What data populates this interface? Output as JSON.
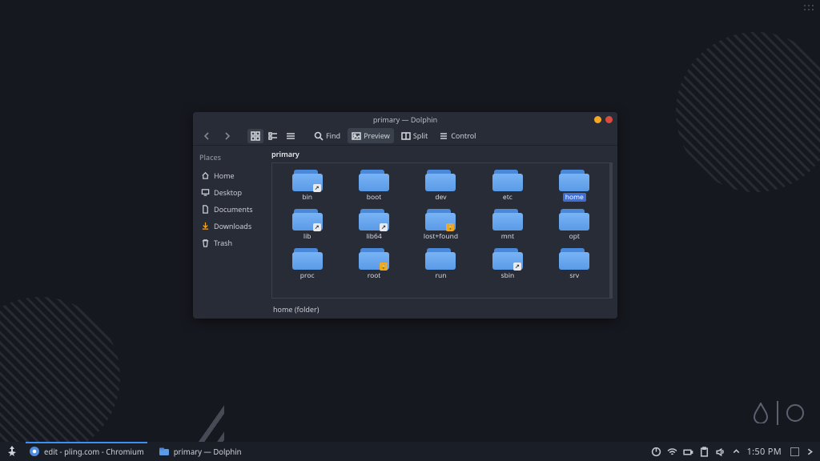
{
  "wallpaper": {
    "brand": "inkscape-style"
  },
  "window": {
    "title": "primary — Dolphin",
    "toolbar": {
      "find": "Find",
      "preview": "Preview",
      "split": "Split",
      "control": "Control"
    },
    "sidebar": {
      "heading": "Places",
      "items": [
        {
          "icon": "home",
          "label": "Home"
        },
        {
          "icon": "desktop",
          "label": "Desktop"
        },
        {
          "icon": "document",
          "label": "Documents"
        },
        {
          "icon": "download",
          "label": "Downloads"
        },
        {
          "icon": "trash",
          "label": "Trash"
        }
      ]
    },
    "path": "primary",
    "folders": [
      {
        "name": "bin",
        "emblem": "link"
      },
      {
        "name": "boot",
        "emblem": null
      },
      {
        "name": "dev",
        "emblem": null
      },
      {
        "name": "etc",
        "emblem": null
      },
      {
        "name": "home",
        "emblem": null,
        "selected": true
      },
      {
        "name": "lib",
        "emblem": "link"
      },
      {
        "name": "lib64",
        "emblem": "link"
      },
      {
        "name": "lost+found",
        "emblem": "lock"
      },
      {
        "name": "mnt",
        "emblem": null
      },
      {
        "name": "opt",
        "emblem": null
      },
      {
        "name": "proc",
        "emblem": null
      },
      {
        "name": "root",
        "emblem": "lock"
      },
      {
        "name": "run",
        "emblem": null
      },
      {
        "name": "sbin",
        "emblem": "link"
      },
      {
        "name": "srv",
        "emblem": null
      }
    ],
    "status": "home (folder)"
  },
  "taskbar": {
    "tasks": [
      {
        "icon": "chromium",
        "label": "edit - pling.com - Chromium",
        "active": true
      },
      {
        "icon": "dolphin",
        "label": "primary — Dolphin",
        "active": false
      }
    ],
    "clock": "1:50 PM"
  }
}
